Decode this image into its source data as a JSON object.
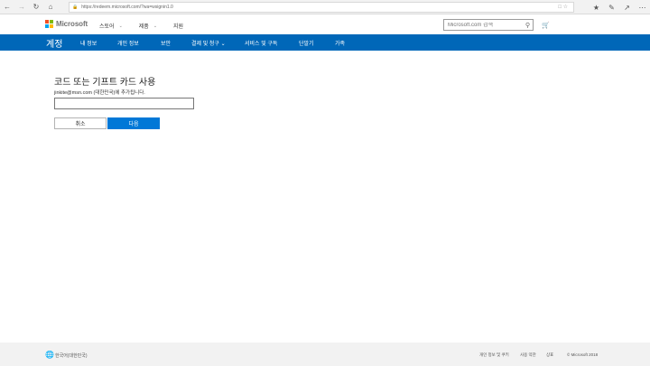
{
  "browser": {
    "url": "https://redeem.microsoft.com/?wa=wsignin1.0"
  },
  "header": {
    "brand": "Microsoft",
    "nav": [
      {
        "label": "스토어"
      },
      {
        "label": "제품"
      },
      {
        "label": "지원"
      }
    ],
    "search_placeholder": "Microsoft.com 검색"
  },
  "account_nav": {
    "title": "계정",
    "items": [
      {
        "label": "내 정보"
      },
      {
        "label": "개인 정보"
      },
      {
        "label": "보안"
      },
      {
        "label": "결제 및 청구"
      },
      {
        "label": "서비스 및 구독"
      },
      {
        "label": "단말기"
      },
      {
        "label": "가족"
      }
    ]
  },
  "redeem": {
    "title": "코드 또는 기프트 카드 사용",
    "subtitle": "jinkite@msn.com (대한민국)에 추가됩니다.",
    "input_value": "",
    "cancel_label": "취소",
    "next_label": "다음"
  },
  "footer": {
    "locale": "한국어(대한민국)",
    "links": [
      "개인 정보 및 쿠키",
      "사용 약관",
      "상표",
      "© Microsoft 2018"
    ]
  },
  "colors": {
    "accent": "#0067b8",
    "button_primary": "#0078d7",
    "logo": [
      "#f25022",
      "#7fba00",
      "#00a4ef",
      "#ffb900"
    ]
  }
}
